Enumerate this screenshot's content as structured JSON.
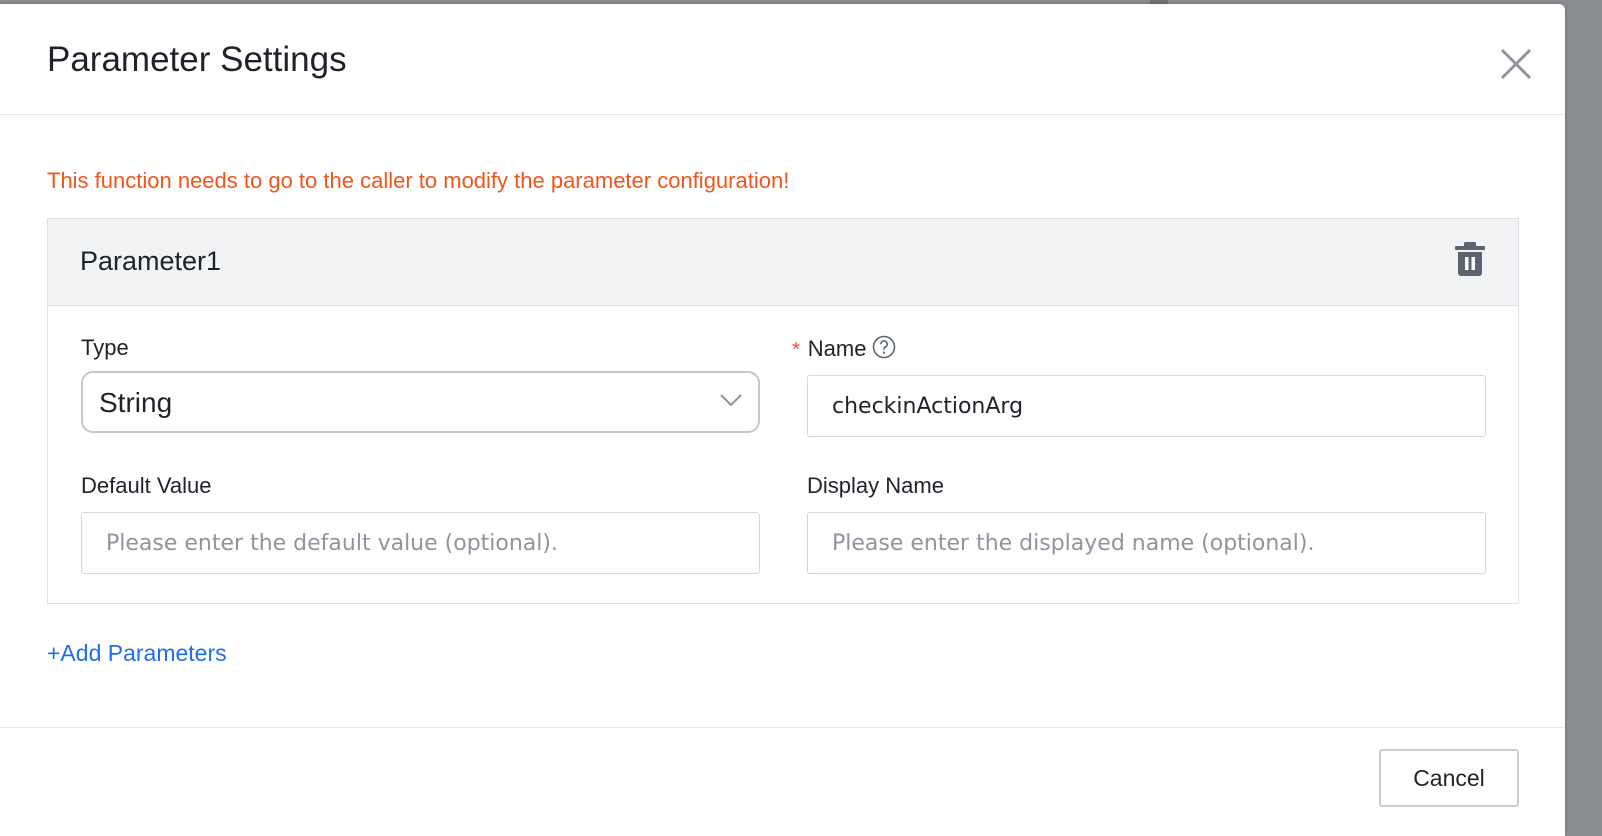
{
  "dialog": {
    "title": "Parameter Settings",
    "warning": "This function needs to go to the caller to modify the parameter configuration!",
    "close_icon": "close-icon",
    "colors": {
      "warning": "#f2541b",
      "link": "#1f6feb",
      "required": "#f54a45"
    }
  },
  "parameter": {
    "title": "Parameter1",
    "delete_icon": "trash-icon",
    "type": {
      "label": "Type",
      "value": "String"
    },
    "name": {
      "label": "Name",
      "required_mark": "*",
      "value": "checkinActionArg",
      "help_icon": "question-circle-icon"
    },
    "default_value": {
      "label": "Default Value",
      "value": "",
      "placeholder": "Please enter the default value (optional)."
    },
    "display_name": {
      "label": "Display Name",
      "value": "",
      "placeholder": "Please enter the displayed name (optional)."
    }
  },
  "add_parameters_label": "+Add Parameters",
  "footer": {
    "cancel_label": "Cancel"
  }
}
